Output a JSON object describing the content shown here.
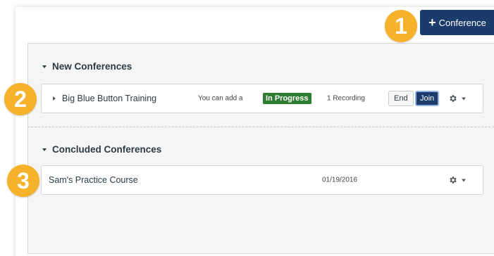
{
  "toolbar": {
    "add_conference_label": "Conference"
  },
  "sections": [
    {
      "title": "New Conferences",
      "items": [
        {
          "name": "Big Blue Button Training",
          "note": "You can add a",
          "status": "In Progress",
          "recordings": "1 Recording",
          "end_label": "End",
          "join_label": "Join"
        }
      ]
    },
    {
      "title": "Concluded Conferences",
      "items": [
        {
          "name": "Sam's Practice Course",
          "date": "01/19/2016"
        }
      ]
    }
  ],
  "callouts": [
    "1",
    "2",
    "3"
  ],
  "colors": {
    "primary": "#1b3c6b",
    "status_green": "#2e7d32",
    "callout": "#f6b22b"
  },
  "icons": [
    "plus-icon",
    "caret-down-icon",
    "caret-right-icon",
    "gear-icon"
  ]
}
